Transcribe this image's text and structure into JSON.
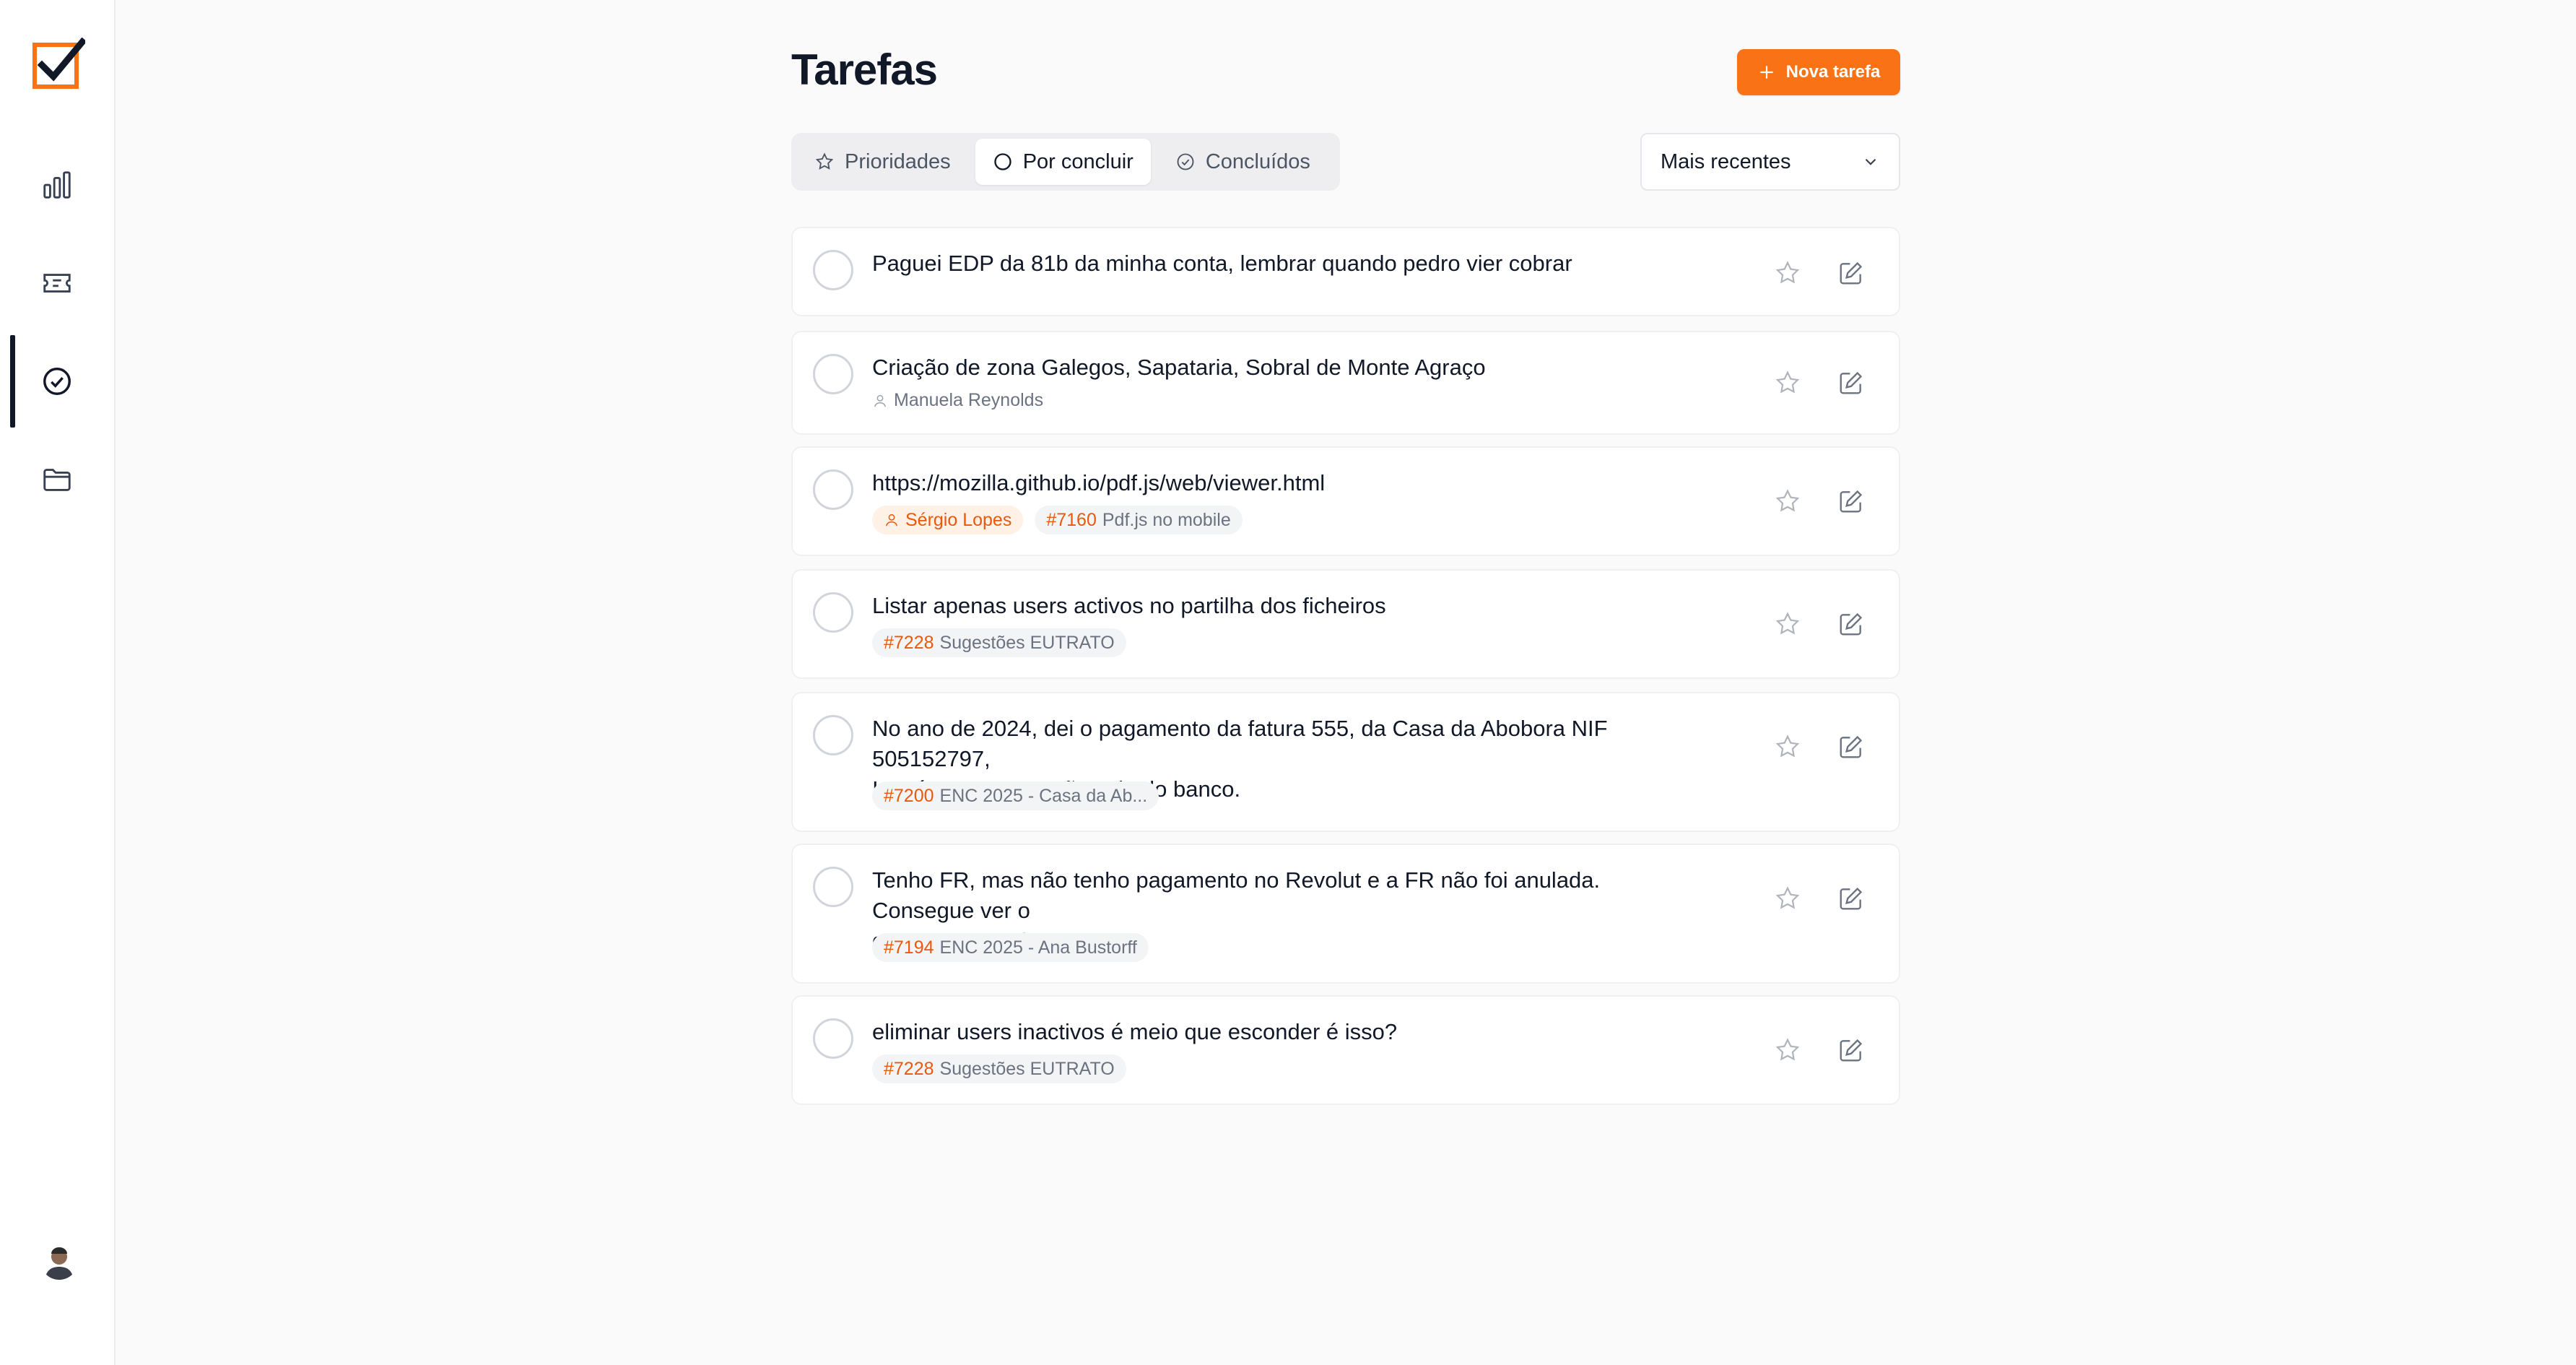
{
  "colors": {
    "accent": "#f97316",
    "accent_text": "#ea580c",
    "text": "#111827",
    "muted": "#6b7280"
  },
  "sidebar": {
    "logo": "checkbox-logo",
    "items": [
      {
        "icon": "bar-chart-icon"
      },
      {
        "icon": "ticket-icon"
      },
      {
        "icon": "check-circle-icon",
        "active": true
      },
      {
        "icon": "folder-icon"
      }
    ],
    "avatar": "user-avatar"
  },
  "header": {
    "title": "Tarefas",
    "new_button_label": "Nova tarefa"
  },
  "tabs": [
    {
      "label": "Prioridades",
      "icon": "star-icon"
    },
    {
      "label": "Por concluir",
      "icon": "circle-icon",
      "active": true
    },
    {
      "label": "Concluídos",
      "icon": "check-circle-icon"
    }
  ],
  "sort": {
    "selected": "Mais recentes"
  },
  "tasks": [
    {
      "title": "Paguei EDP da 81b da minha conta, lembrar quando pedro vier cobrar"
    },
    {
      "title": "Criação de zona Galegos, Sapataria, Sobral de Monte Agraço",
      "assignee": "Manuela Reynolds"
    },
    {
      "title": "https://mozilla.github.io/pdf.js/web/viewer.html",
      "assignee": "Sérgio Lopes",
      "ticket_number": "#7160",
      "ticket_title": "Pdf.js no mobile"
    },
    {
      "title": "Listar apenas users activos no partilha dos ficheiros",
      "ticket_number": "#7228",
      "ticket_title": "Sugestões EUTRATO"
    },
    {
      "title_line1": "No ano de 2024, dei o pagamento da fatura 555, da Casa da Abobora NIF 505152797,",
      "title_line2": "Isto é Zome, mas não saiu do banco.",
      "ticket_number": "#7200",
      "ticket_title": "ENC 2025 - Casa da Ab..."
    },
    {
      "title_line1": "Tenho FR, mas não tenho pagamento no Revolut e a FR não foi anulada. Consegue ver o",
      "title_line2": "que se passou?",
      "ticket_number": "#7194",
      "ticket_title": "ENC 2025 - Ana Bustorff"
    },
    {
      "title": "eliminar users inactivos é meio que esconder é isso?",
      "ticket_number": "#7228",
      "ticket_title": "Sugestões EUTRATO"
    }
  ]
}
